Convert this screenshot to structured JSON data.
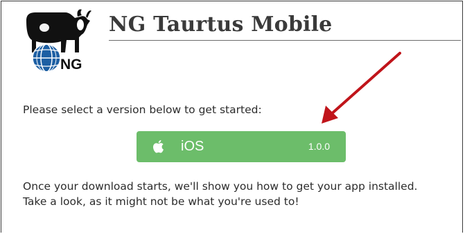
{
  "app": {
    "title": "NG Taurtus Mobile",
    "logo_text": "NG",
    "logo_icon": "bull-and-globe-logo"
  },
  "content": {
    "intro": "Please select a version below to get started:",
    "outro": "Once your download starts, we'll show you how to get your app installed. Take a look, as it might not be what you're used to!"
  },
  "download_button": {
    "platform": "iOS",
    "version": "1.0.0",
    "icon": "apple-icon",
    "color": "#6cbd6a"
  },
  "annotation": {
    "icon": "red-arrow",
    "color": "#c0141a"
  }
}
